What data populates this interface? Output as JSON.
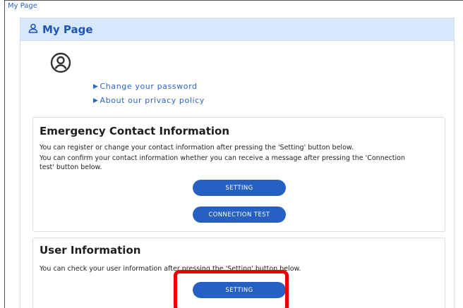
{
  "breadcrumb": "My Page",
  "header": {
    "title": "My Page",
    "icon": "user-icon"
  },
  "profile": {
    "avatar_icon": "user-circle-icon"
  },
  "links": [
    {
      "label": "Change your password",
      "icon": "triangle-right-icon"
    },
    {
      "label": "About our privacy policy",
      "icon": "triangle-right-icon"
    }
  ],
  "emergency": {
    "title": "Emergency Contact Information",
    "line1": "You can register or change your contact information after pressing the 'Setting' button below.",
    "line2": "You can confirm your contact information whether you can receive a message after pressing the 'Connection",
    "line3": "test' button below.",
    "setting_label": "SETTING",
    "connection_label": "CONNECTION TEST"
  },
  "user_info": {
    "title": "User Information",
    "line1": "You can check your user information after pressing the 'Setting' button below.",
    "setting_label": "SETTING"
  },
  "colors": {
    "accent": "#2560c2",
    "header_bg": "#d8e8fb",
    "highlight": "#e80000"
  }
}
